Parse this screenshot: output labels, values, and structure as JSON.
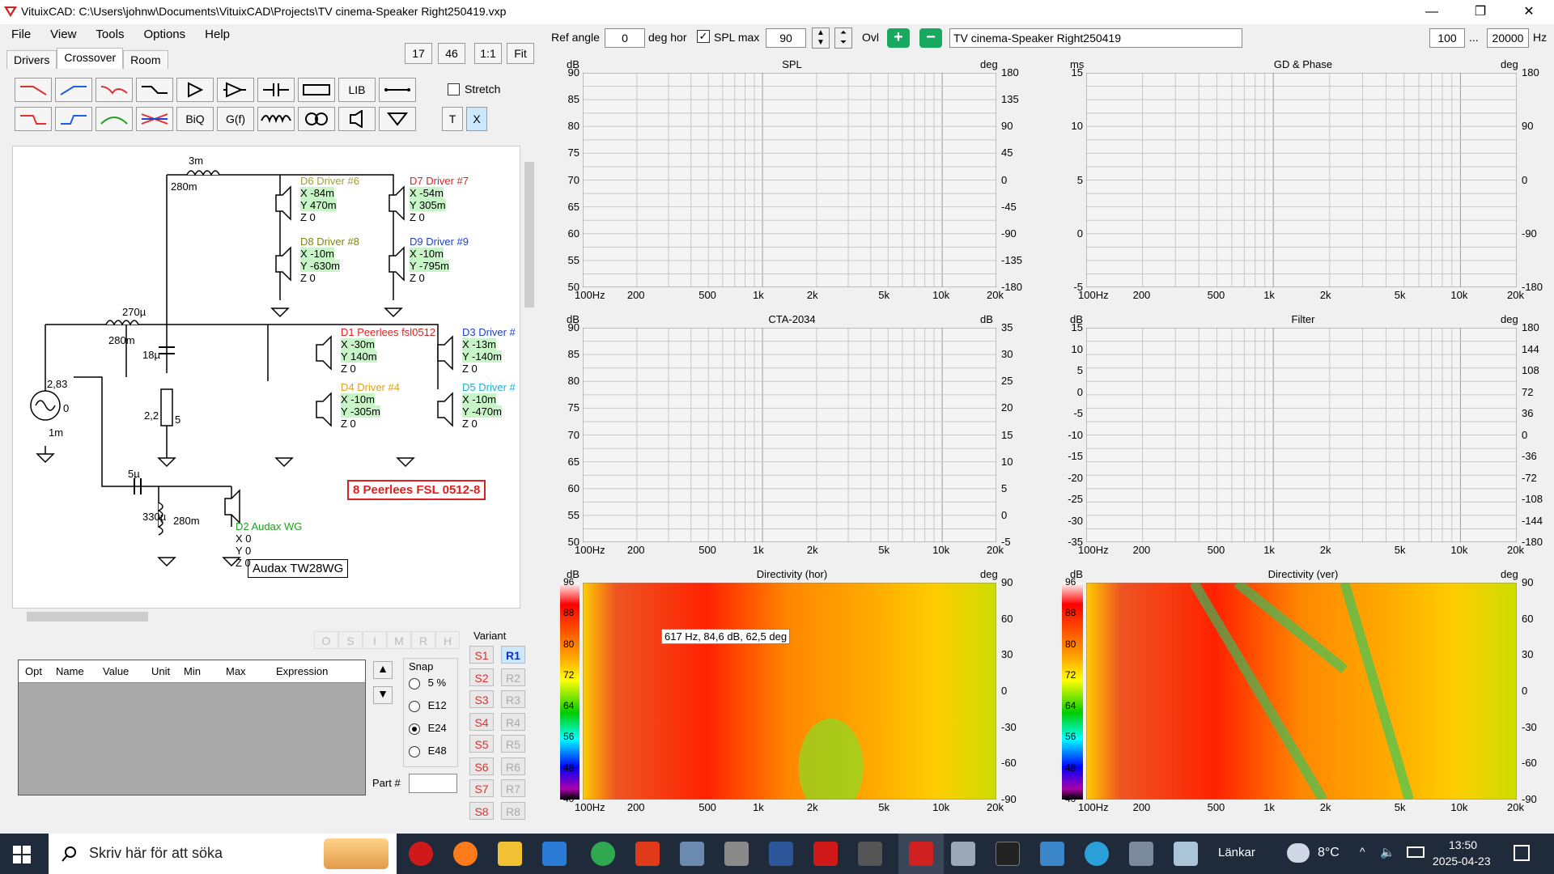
{
  "window": {
    "title": "VituixCAD: C:\\Users\\johnw\\Documents\\VituixCAD\\Projects\\TV cinema-Speaker Right250419.vxp"
  },
  "menu": [
    "File",
    "View",
    "Tools",
    "Options",
    "Help"
  ],
  "tabs": [
    "Drivers",
    "Crossover",
    "Room"
  ],
  "zoom_buttons": [
    "17",
    "46",
    "1:1",
    "Fit"
  ],
  "toolbar": {
    "stretch_label": "Stretch",
    "lib": "LIB",
    "biq": "BiQ",
    "gf": "G(f)",
    "t": "T",
    "x": "X"
  },
  "topbar": {
    "ref_angle_label": "Ref angle",
    "ref_angle_value": "0",
    "deg_hor": "deg hor",
    "splmax_label": "SPL max",
    "splmax_value": "90",
    "ovl": "Ovl",
    "filename": "TV cinema-Speaker Right250419",
    "f_lo": "100",
    "dots": "...",
    "f_hi": "20000",
    "hz": "Hz"
  },
  "schematic": {
    "l1_value": "3m",
    "l1_r": "280m",
    "l2_value": "270µ",
    "l2_r": "280m",
    "c1": "18µ",
    "r1a": "2,2",
    "r1b": "5",
    "src_v": "2,83",
    "src_phase": "0",
    "src_r": "1m",
    "c2": "5µ",
    "l3": "330µ",
    "l3_r": "280m",
    "label_box": "8 Peerlees FSL 0512-8",
    "label_box2": "Audax TW28WG",
    "drivers": [
      {
        "name": "D6 Driver #6",
        "x": "X -84m",
        "y": "Y 470m",
        "z": "Z 0",
        "color": "#a0a030"
      },
      {
        "name": "D7 Driver #7",
        "x": "X -54m",
        "y": "Y 305m",
        "z": "Z 0",
        "color": "#e02020"
      },
      {
        "name": "D8 Driver #8",
        "x": "X -10m",
        "y": "Y -630m",
        "z": "Z 0",
        "color": "#808020"
      },
      {
        "name": "D9 Driver #9",
        "x": "X -10m",
        "y": "Y -795m",
        "z": "Z 0",
        "color": "#2040d0"
      },
      {
        "name": "D1 Peerlees fsl0512",
        "x": "X -30m",
        "y": "Y 140m",
        "z": "Z 0",
        "color": "#e02020"
      },
      {
        "name": "D3 Driver #",
        "x": "X -13m",
        "y": "Y -140m",
        "z": "Z 0",
        "color": "#2040d0"
      },
      {
        "name": "D4 Driver #4",
        "x": "X -10m",
        "y": "Y -305m",
        "z": "Z 0",
        "color": "#e0a020"
      },
      {
        "name": "D5 Driver #",
        "x": "X -10m",
        "y": "Y -470m",
        "z": "Z 0",
        "color": "#20b0d0"
      },
      {
        "name": "D2 Audax WG",
        "x": "X 0",
        "y": "Y 0",
        "z": "Z 0",
        "color": "#20a020"
      }
    ]
  },
  "opt_table": {
    "headers": [
      "Opt",
      "Name",
      "Value",
      "Unit",
      "Min",
      "Max",
      "Expression"
    ]
  },
  "snap": {
    "label": "Snap",
    "options": [
      "5 %",
      "E12",
      "E24",
      "E48"
    ],
    "selected": "E24"
  },
  "part_label": "Part #",
  "variant": {
    "label": "Variant",
    "s": [
      "S1",
      "S2",
      "S3",
      "S4",
      "S5",
      "S6",
      "S7",
      "S8"
    ],
    "r": [
      "R1",
      "R2",
      "R3",
      "R4",
      "R5",
      "R6",
      "R7",
      "R8"
    ]
  },
  "faded_buttons": [
    "O",
    "S",
    "I",
    "M",
    "R",
    "H"
  ],
  "plots": {
    "spl": {
      "title": "SPL",
      "yl": "dB",
      "yr": "deg",
      "y_ticks": [
        "90",
        "85",
        "80",
        "75",
        "70",
        "65",
        "60",
        "55",
        "50"
      ],
      "yr_ticks": [
        "180",
        "135",
        "90",
        "45",
        "0",
        "-45",
        "-90",
        "-135",
        "-180"
      ]
    },
    "gd": {
      "title": "GD & Phase",
      "yl": "ms",
      "yr": "deg",
      "y_ticks": [
        "15",
        "10",
        "5",
        "0",
        "-5"
      ],
      "yr_ticks": [
        "180",
        "90",
        "0",
        "-90",
        "-180"
      ]
    },
    "cta": {
      "title": "CTA-2034",
      "yl": "dB",
      "yr": "dB",
      "y_ticks": [
        "90",
        "85",
        "80",
        "75",
        "70",
        "65",
        "60",
        "55",
        "50"
      ],
      "yr_ticks": [
        "35",
        "30",
        "25",
        "20",
        "15",
        "10",
        "5",
        "0",
        "-5"
      ]
    },
    "filter": {
      "title": "Filter",
      "yl": "dB",
      "yr": "deg",
      "y_ticks": [
        "15",
        "10",
        "5",
        "0",
        "-5",
        "-10",
        "-15",
        "-20",
        "-25",
        "-30",
        "-35"
      ],
      "yr_ticks": [
        "180",
        "144",
        "108",
        "72",
        "36",
        "0",
        "-36",
        "-72",
        "-108",
        "-144",
        "-180"
      ]
    },
    "dirh": {
      "title": "Directivity (hor)",
      "yl": "dB",
      "yr": "deg",
      "scale": [
        "96",
        "88",
        "80",
        "72",
        "64",
        "56",
        "48",
        "40"
      ],
      "yr_ticks": [
        "90",
        "60",
        "30",
        "0",
        "-30",
        "-60",
        "-90"
      ],
      "tooltip": "617 Hz, 84,6 dB, 62,5 deg"
    },
    "dirv": {
      "title": "Directivity (ver)",
      "yl": "dB",
      "yr": "deg",
      "scale": [
        "96",
        "88",
        "80",
        "72",
        "64",
        "56",
        "48",
        "40"
      ],
      "yr_ticks": [
        "90",
        "60",
        "30",
        "0",
        "-30",
        "-60",
        "-90"
      ]
    },
    "x_ticks": [
      "100Hz",
      "200",
      "500",
      "1k",
      "2k",
      "5k",
      "10k",
      "20k"
    ]
  },
  "taskbar": {
    "search": "Skriv här för att söka",
    "links": "Länkar",
    "temp": "8°C",
    "time": "13:50",
    "date": "2025-04-23"
  }
}
